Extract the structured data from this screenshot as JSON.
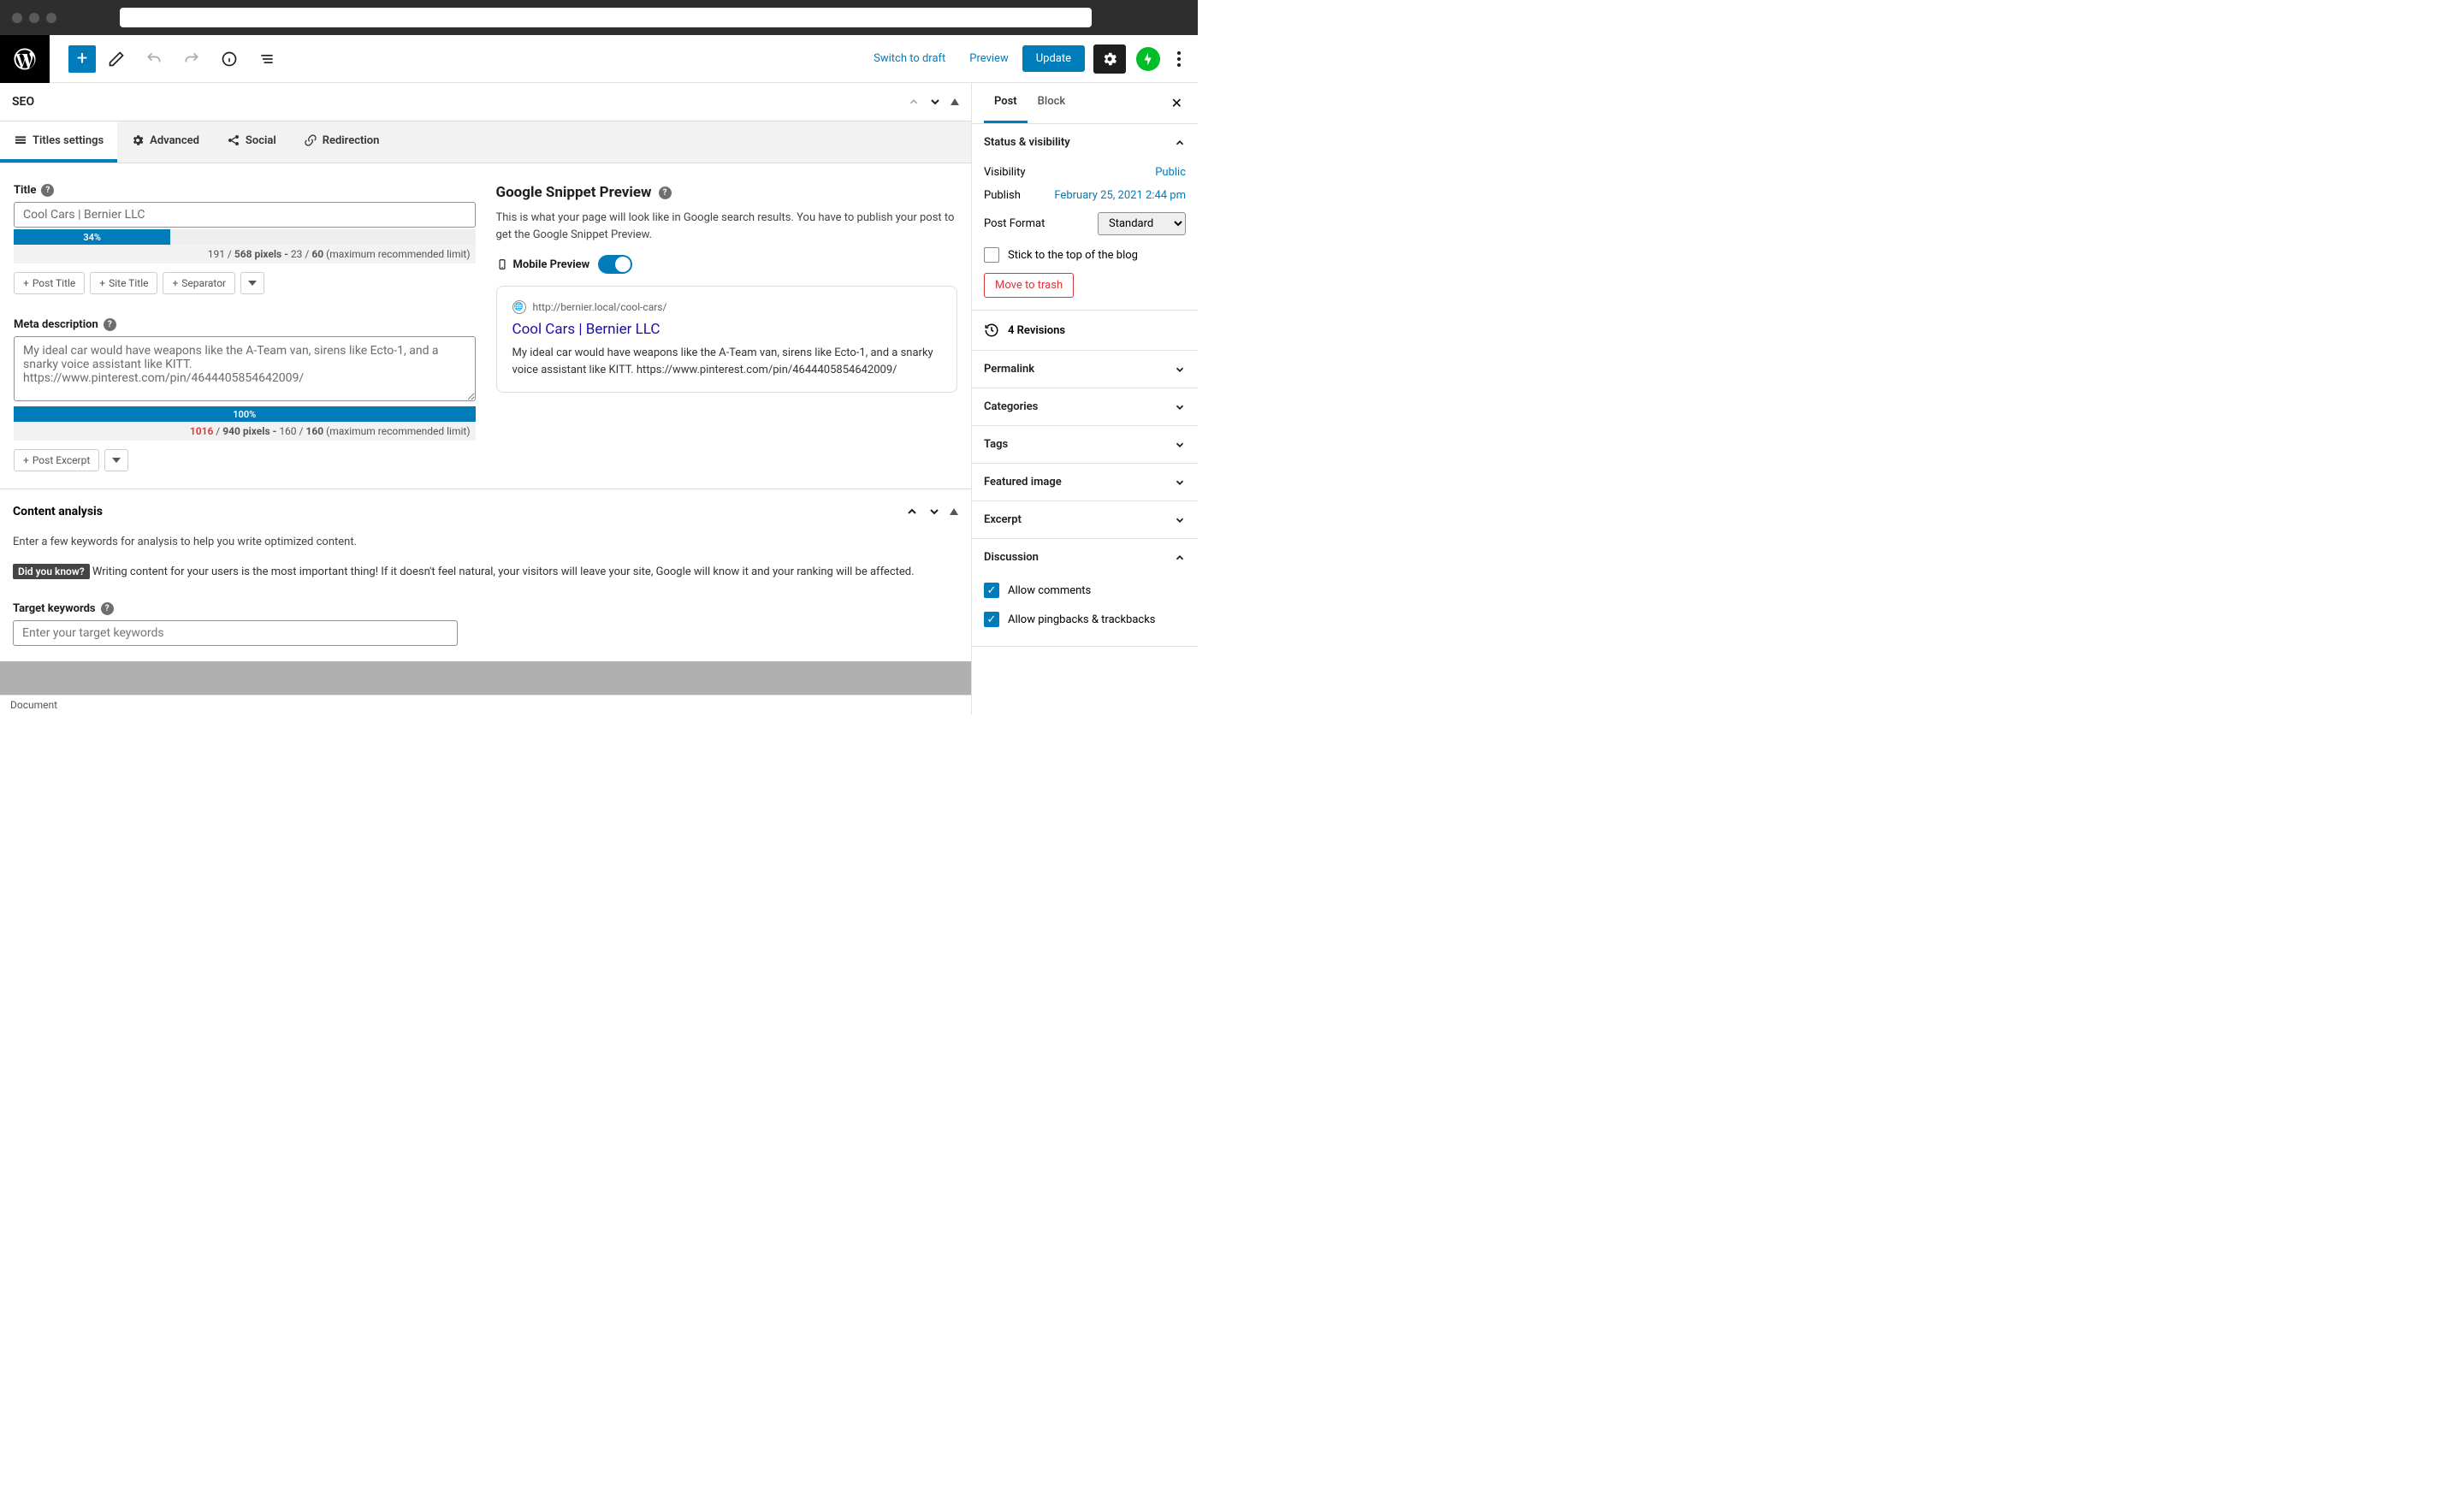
{
  "toolbar": {
    "switch_draft": "Switch to draft",
    "preview": "Preview",
    "update": "Update"
  },
  "seo": {
    "panel_title": "SEO",
    "tabs": {
      "titles": "Titles settings",
      "advanced": "Advanced",
      "social": "Social",
      "redirection": "Redirection"
    },
    "title_label": "Title",
    "title_value": "Cool Cars | Bernier LLC",
    "title_progress": "34%",
    "title_stats_a": "191",
    "title_stats_b": "568 pixels -",
    "title_stats_c": "23",
    "title_stats_d": "60",
    "title_stats_suffix": "(maximum recommended limit)",
    "btn_post_title": "Post Title",
    "btn_site_title": "Site Title",
    "btn_separator": "Separator",
    "meta_label": "Meta description",
    "meta_value": "My ideal car would have weapons like the A-Team van, sirens like Ecto-1, and a snarky voice assistant like KITT. https://www.pinterest.com/pin/4644405854642009/",
    "meta_progress": "100%",
    "meta_stats_a": "1016",
    "meta_stats_b": "940 pixels -",
    "meta_stats_c": "160",
    "meta_stats_d": "160",
    "btn_post_excerpt": "Post Excerpt"
  },
  "snippet": {
    "heading": "Google Snippet Preview",
    "desc": "This is what your page will look like in Google search results. You have to publish your post to get the Google Snippet Preview.",
    "mobile_label": "Mobile Preview",
    "url": "http://bernier.local/cool-cars/",
    "title": "Cool Cars | Bernier LLC",
    "text": "My ideal car would have weapons like the A-Team van, sirens like Ecto-1, and a snarky voice assistant like KITT. https://www.pinterest.com/pin/4644405854642009/"
  },
  "analysis": {
    "title": "Content analysis",
    "intro": "Enter a few keywords for analysis to help you write optimized content.",
    "tip_tag": "Did you know?",
    "tip_text": "Writing content for your users is the most important thing! If it doesn't feel natural, your visitors will leave your site, Google will know it and your ranking will be affected.",
    "keywords_label": "Target keywords",
    "keywords_placeholder": "Enter your target keywords"
  },
  "sidebar": {
    "tabs": {
      "post": "Post",
      "block": "Block"
    },
    "status_title": "Status & visibility",
    "visibility_label": "Visibility",
    "visibility_value": "Public",
    "publish_label": "Publish",
    "publish_value": "February 25, 2021 2:44 pm",
    "format_label": "Post Format",
    "format_value": "Standard",
    "stick_label": "Stick to the top of the blog",
    "trash": "Move to trash",
    "revisions": "4 Revisions",
    "permalink": "Permalink",
    "categories": "Categories",
    "tags": "Tags",
    "featured": "Featured image",
    "excerpt": "Excerpt",
    "discussion": "Discussion",
    "allow_comments": "Allow comments",
    "allow_pingbacks": "Allow pingbacks & trackbacks"
  },
  "footer": {
    "document": "Document"
  }
}
